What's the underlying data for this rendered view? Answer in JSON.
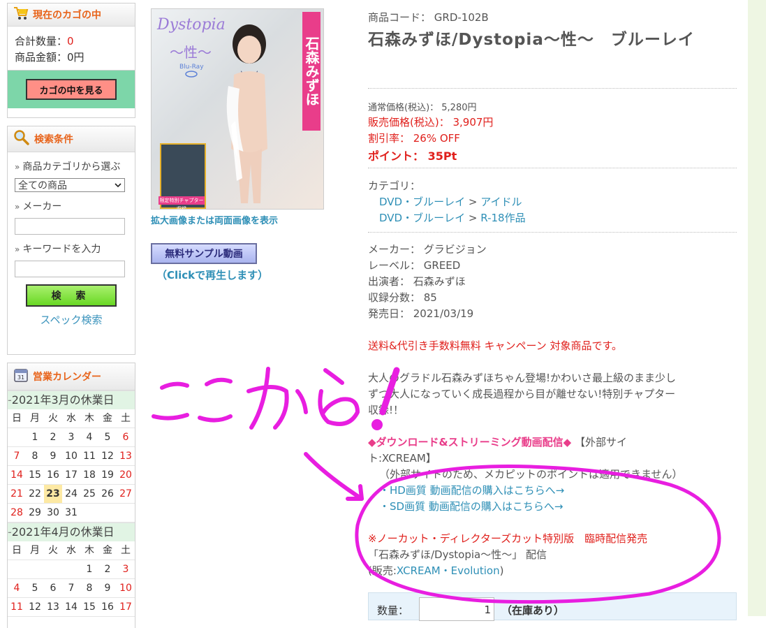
{
  "cart": {
    "title": "現在のカゴの中",
    "qty_label": "合計数量：",
    "qty_value": "0",
    "amount_label": "商品金額：0円",
    "view_button": "カゴの中を見る"
  },
  "search": {
    "title": "検索条件",
    "category_label": "商品カテゴリから選ぶ",
    "category_selected": "全ての商品",
    "maker_label": "メーカー",
    "keyword_label": "キーワードを入力",
    "search_button": "検 索",
    "spec_link": "スペック検索"
  },
  "calendar": {
    "title": "営業カレンダー",
    "weekdays": [
      "日",
      "月",
      "火",
      "水",
      "木",
      "金",
      "土"
    ],
    "march_title": "2021年3月の休業日",
    "april_title": "2021年4月の休業日",
    "march_rows": [
      [
        "",
        "1",
        "2",
        "3",
        "4",
        "5",
        "6"
      ],
      [
        "7",
        "8",
        "9",
        "10",
        "11",
        "12",
        "13"
      ],
      [
        "14",
        "15",
        "16",
        "17",
        "18",
        "19",
        "20"
      ],
      [
        "21",
        "22",
        "23",
        "24",
        "25",
        "26",
        "27"
      ],
      [
        "28",
        "29",
        "30",
        "31",
        "",
        "",
        ""
      ]
    ],
    "april_rows": [
      [
        "",
        "",
        "",
        "",
        "1",
        "2",
        "3"
      ],
      [
        "4",
        "5",
        "6",
        "7",
        "8",
        "9",
        "10"
      ],
      [
        "11",
        "12",
        "13",
        "14",
        "15",
        "16",
        "17"
      ]
    ],
    "today": "23"
  },
  "product_image": {
    "title_text": "Dystopia",
    "subtitle_text": "〜性〜",
    "format_text": "Blu-Ray",
    "name_text": "石森みずほ",
    "inset_caption": "限定特別チャプター収録",
    "enlarge_link": "拡大画像または両面画像を表示",
    "sample_button": "無料サンプル動画",
    "sample_note": "（Clickで再生します）"
  },
  "product": {
    "code_label": "商品コード： GRD-102B",
    "title": "石森みずほ/Dystopia〜性〜　ブルーレイ",
    "regular_price": "通常価格(税込)： 5,280円",
    "sale_price": "販売価格(税込)： 3,907円",
    "discount": "割引率： 26% OFF",
    "points": "ポイント： 35Pt",
    "category_label": "カテゴリ：",
    "category_path_1_a": "DVD・ブルーレイ",
    "category_path_1_b": "アイドル",
    "category_path_2_a": "DVD・ブルーレイ",
    "category_path_2_b": "R-18作品",
    "separator": ">",
    "maker": "メーカー： グラビジョン",
    "label": "レーベル： GREED",
    "performer": "出演者： 石森みずほ",
    "runtime": "収録分数： 85",
    "release": "発売日： 2021/03/19",
    "campaign": "送料&代引き手数料無料 キャンペーン 対象商品です。",
    "description_1": "大人のグラドル石森みずほちゃん登場!かわいさ最上級のまま少し",
    "description_2": "ずつ大人になっていく成長過程から目が離せない!特別チャプター",
    "description_3": "収録!！",
    "dl_heading": "◆ダウンロード&ストリーミング動画配信◆",
    "dl_site_1": "【外部サイ",
    "dl_site_2": "ト:XCREAM】",
    "dl_note": "（外部サイトのため、メカピットのポイントは適用できません）",
    "hd_link": "・HD画質 動画配信の購入はこちらへ→",
    "sd_link": "・SD画質 動画配信の購入はこちらへ→",
    "special_notice": "※ノーカット・ディレクターズカット特別版　臨時配信発売",
    "special_title": "「石森みずほ/Dystopia〜性〜」 配信",
    "sold_by_prefix": "(販売:",
    "sold_by_link": "XCREAM・Evolution",
    "sold_by_suffix": ")",
    "qty_label": "数量：",
    "qty_value": "1",
    "stock": "（在庫あり）"
  },
  "annotation": {
    "handwritten_text": "ここから!",
    "color": "#e81ee0"
  },
  "colors": {
    "accent_orange": "#e8641b",
    "link_blue": "#2e8fb6",
    "sale_red": "#e0201c",
    "cart_footer_green": "#7dd6a9",
    "calendar_header_green": "#e1f4e4"
  }
}
